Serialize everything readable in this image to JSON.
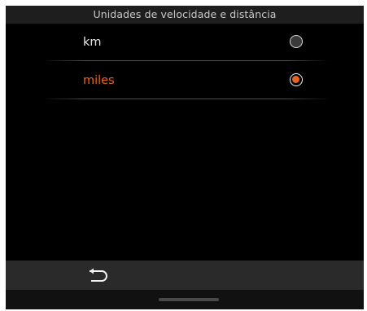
{
  "header": {
    "title": "Unidades de velocidade e distância"
  },
  "options": [
    {
      "label": "km",
      "selected": false
    },
    {
      "label": "miles",
      "selected": true
    }
  ],
  "footer": {
    "back_icon": "back-arrow-icon"
  },
  "colors": {
    "accent": "#e8641e",
    "background": "#000000",
    "title_bar": "#1e1e1e",
    "bottom_bar": "#2a2a2a"
  }
}
